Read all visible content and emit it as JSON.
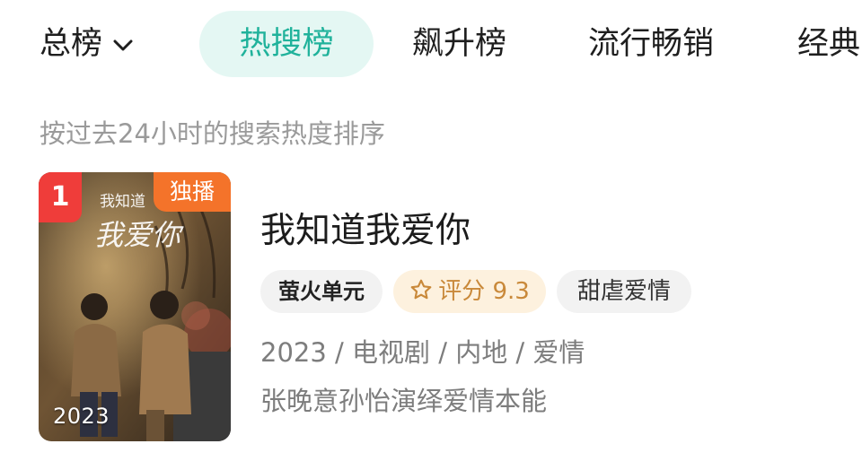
{
  "tabs": {
    "dropdown_label": "总榜",
    "items": [
      {
        "label": "热搜榜",
        "active": true
      },
      {
        "label": "飙升榜",
        "active": false
      },
      {
        "label": "流行畅销",
        "active": false
      },
      {
        "label": "经典",
        "active": false
      }
    ],
    "active_bg": "#e4f7f3",
    "active_color": "#20b29b",
    "chevron_icon": "chevron-down-icon"
  },
  "subtitle": "按过去24小时的搜索热度排序",
  "item": {
    "rank": "1",
    "exclusive_badge": "独播",
    "poster_year": "2023",
    "poster_title_small": "我知道",
    "poster_title_big": "我爱你",
    "title": "我知道我爱你",
    "tags": {
      "brand": "萤火单元",
      "rating_label": "评分 9.3",
      "rating_icon": "star-icon",
      "genre": "甜虐爱情"
    },
    "meta": "2023 / 电视剧 / 内地 / 爱情",
    "description": "张晚意孙怡演绎爱情本能",
    "colors": {
      "rank_badge": "#ef3d3a",
      "exclusive_badge": "#f4732a",
      "rating_bg": "#fdf1de",
      "rating_text": "#c9893a"
    }
  }
}
